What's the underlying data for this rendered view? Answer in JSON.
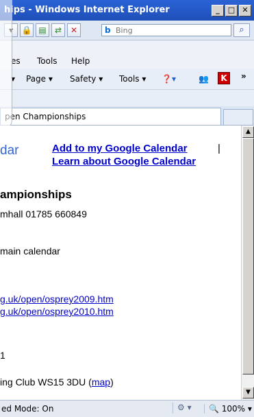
{
  "window": {
    "title": "hips - Windows Internet Explorer",
    "minimize": "_",
    "maximize": "□",
    "close": "✕"
  },
  "search": {
    "engine": "Bing",
    "placeholder": "Bing",
    "go": "⌕"
  },
  "menu": {
    "items": [
      "es",
      "Tools",
      "Help"
    ]
  },
  "commandbar": {
    "page": "Page ▾",
    "safety": "Safety ▾",
    "tools": "Tools ▾",
    "help": "❓▾",
    "expand": "»"
  },
  "tab": {
    "label": "pen Championships"
  },
  "content": {
    "partial_heading": "dar",
    "add_calendar": "Add to my Google Calendar",
    "separator": "|",
    "learn_calendar": "Learn about Google Calendar",
    "event_title": "ampionships",
    "contact": "mhall 01785 660849",
    "calendar": "main calendar",
    "link1": "g.uk/open/osprey2009.htm",
    "link2": "g.uk/open/osprey2010.htm",
    "date_fragment": "1",
    "venue": "ing Club WS15 3DU (",
    "map_link": "map",
    "venue_end": ")"
  },
  "status": {
    "mode": "ed Mode: On",
    "zoom": "100%",
    "zoom_icon": "🔍"
  }
}
